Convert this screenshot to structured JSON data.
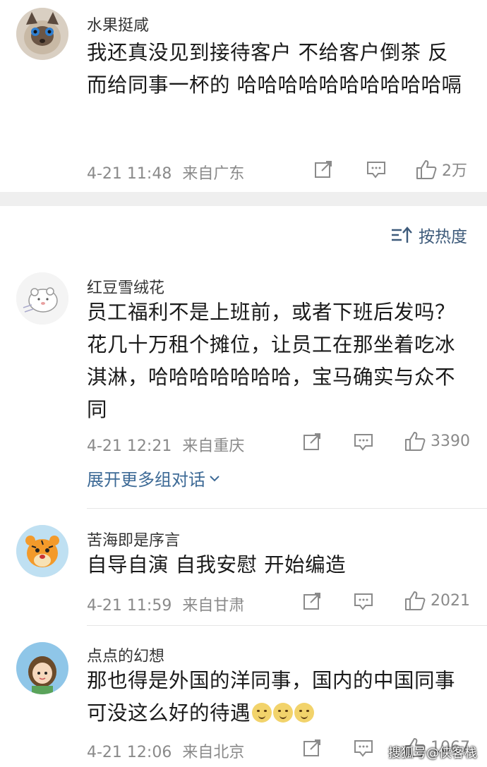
{
  "comments": [
    {
      "username": "水果挺咸",
      "content": "我还真没见到接待客户 不给客户倒茶 反而给同事一杯的 哈哈哈哈哈哈哈哈哈哈嗝",
      "time": "4-21 11:48",
      "location": "来自广东",
      "likes": "2万",
      "avatar_icon": "cat-avatar"
    },
    {
      "username": "红豆雪绒花",
      "content": "员工福利不是上班前，或者下班后发吗？花几十万租个摊位，让员工在那坐着吃冰淇淋，哈哈哈哈哈哈哈，宝马确实与众不同",
      "time": "4-21 12:21",
      "location": "来自重庆",
      "likes": "3390",
      "avatar_icon": "bear-sketch-avatar"
    },
    {
      "username": "苦海即是序言",
      "content": "自导自演  自我安慰   开始编造",
      "time": "4-21 11:59",
      "location": "来自甘肃",
      "likes": "2021",
      "avatar_icon": "tiger-avatar"
    },
    {
      "username": "点点的幻想",
      "content": "那也得是外国的洋同事，国内的中国同事可没这么好的待遇",
      "time": "4-21 12:06",
      "location": "来自北京",
      "likes": "1067",
      "avatar_icon": "girl-avatar"
    }
  ],
  "sort_label": "按热度",
  "expand_label": "展开更多组对话",
  "watermark": "搜狐号@侠客栈",
  "colors": {
    "link": "#3d6a96",
    "meta": "#8a8a8a",
    "divider": "#efefef"
  }
}
